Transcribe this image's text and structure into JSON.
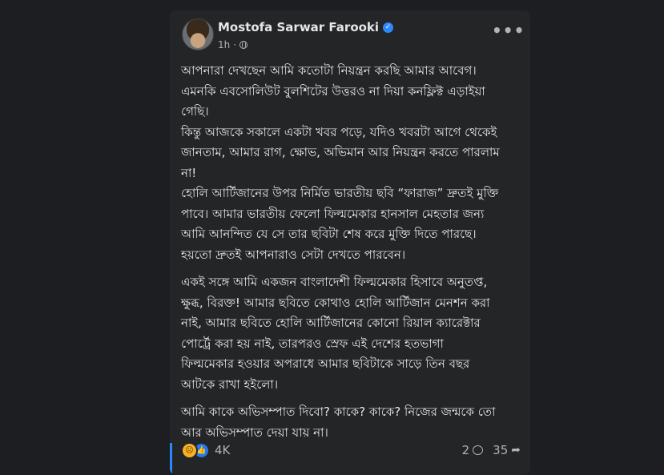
{
  "post": {
    "author": "Mostofa Sarwar Farooki",
    "verified_icon": "verified-badge-icon",
    "time": "1h",
    "separator": "·",
    "audience_icon": "globe-icon",
    "more_icon": "•••",
    "paragraphs": [
      {
        "lines": [
          "আপনারা দেখছেন আমি কতোটা নিয়ন্ত্রন করছি আমার আবেগ।",
          "এমনকি এবসোলিউট বুলশিটের উত্তরও না দিয়া কনফ্লিক্ট এড়াইয়া",
          "গেছি।",
          "কিন্তু আজকে সকালে একটা খবর পড়ে, যদিও খবরটা আগে থেকেই",
          "জানতাম, আমার রাগ, ক্ষোভ, অভিমান আর নিয়ন্ত্রন করতে পারলাম",
          "না!",
          "হোলি আর্টিজানের উপর নির্মিত ভারতীয় ছবি “ফারাজ” দ্রুতই মুক্তি",
          "পাবে। আমার ভারতীয় ফেলো ফিল্মমেকার হানসাল মেহতার জন্য",
          "আমি আনন্দিত যে সে তার ছবিটা শেষ করে মুক্তি দিতে পারছে।",
          "হয়তো দ্রুতই আপনারাও সেটা দেখতে পারবেন।"
        ]
      },
      {
        "lines": [
          "একই সঙ্গে আমি একজন বাংলাদেশী ফিল্মমেকার হিসাবে অনুতপ্ত,",
          "ক্ষুব্ধ, বিরক্ত! আমার ছবিতে কোথাও হোলি আর্টিজান মেনশন করা",
          "নাই, আমার ছবিতে হোলি আর্টিজানের কোনো রিয়াল ক্যারেক্টার",
          "পোর্ট্রে করা হয় নাই, তারপরও স্রেফ এই দেশের হতভাগা",
          "ফিল্মমেকার হওয়ার অপরাধে আমার ছবিটাকে সাড়ে তিন বছর",
          "আটকে রাখা হইলো।"
        ]
      },
      {
        "lines": [
          "আমি কাকে অভিসম্পাত দিবো? কাকে? কাকে? নিজের জন্মকে তো",
          "আর অভিসম্পাত দেয়া যায় না।"
        ]
      }
    ],
    "reactions": {
      "icons": [
        "sad-reaction-icon",
        "like-reaction-icon"
      ],
      "count": "4K",
      "comments": "2",
      "shares": "35"
    }
  },
  "colors": {
    "background": "#1c1e21",
    "card": "#242526",
    "text": "#e4e6eb",
    "secondary_text": "#b0b3b8",
    "accent": "#2d88ff"
  }
}
